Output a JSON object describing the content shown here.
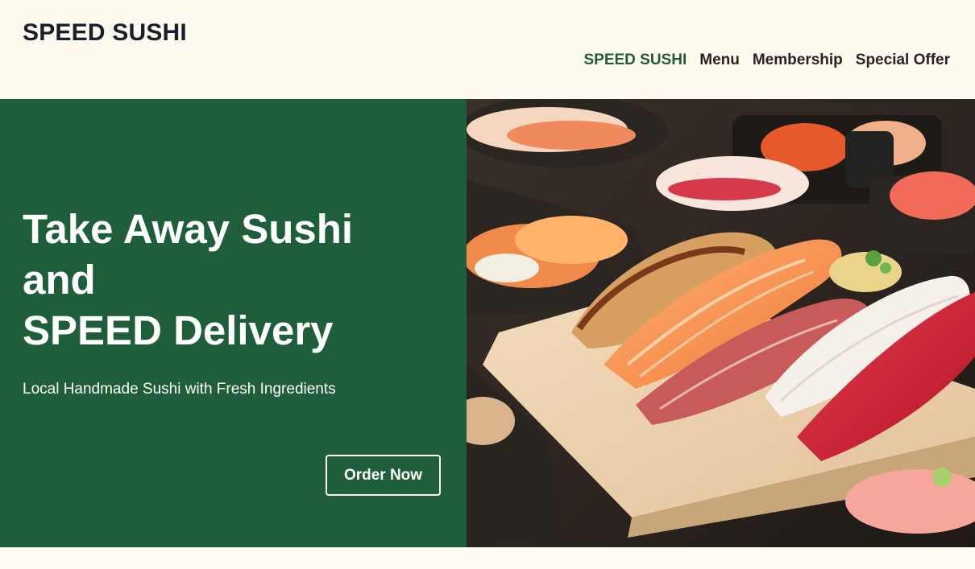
{
  "header": {
    "brand": "SPEED SUSHI",
    "nav": [
      {
        "label": "SPEED SUSHI",
        "active": true
      },
      {
        "label": "Menu",
        "active": false
      },
      {
        "label": "Membership",
        "active": false
      },
      {
        "label": "Special Offer",
        "active": false
      }
    ]
  },
  "hero": {
    "headline": [
      "Take Away Sushi",
      "and",
      "SPEED Delivery"
    ],
    "subtitle": "Local Handmade Sushi with Fresh Ingredients",
    "cta_label": "Order Now",
    "image_icon": "sushi-photo"
  },
  "colors": {
    "background": "#fffaf0",
    "accent_green": "#1f5e3b",
    "text_dark": "#16202a"
  }
}
